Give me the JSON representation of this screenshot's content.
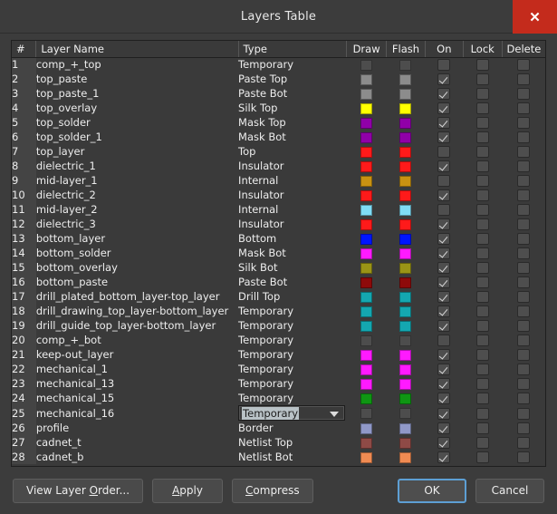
{
  "window": {
    "title": "Layers Table",
    "close_icon": "close-icon",
    "close_label": "✕"
  },
  "table": {
    "columns": [
      "#",
      "Layer Name",
      "Type",
      "Draw",
      "Flash",
      "On",
      "Lock",
      "Delete"
    ],
    "rows": [
      {
        "num": "1",
        "name": "comp_+_top",
        "type": "Temporary",
        "draw": "#4d4d4d",
        "flash": "#4d4d4d",
        "on": false,
        "lock": false,
        "delete": false
      },
      {
        "num": "2",
        "name": "top_paste",
        "type": "Paste Top",
        "draw": "#8c8c8c",
        "flash": "#8c8c8c",
        "on": true,
        "lock": false,
        "delete": false
      },
      {
        "num": "3",
        "name": "top_paste_1",
        "type": "Paste Bot",
        "draw": "#8c8c8c",
        "flash": "#8c8c8c",
        "on": true,
        "lock": false,
        "delete": false
      },
      {
        "num": "4",
        "name": "top_overlay",
        "type": "Silk Top",
        "draw": "#ffff00",
        "flash": "#ffff00",
        "on": true,
        "lock": false,
        "delete": false
      },
      {
        "num": "5",
        "name": "top_solder",
        "type": "Mask Top",
        "draw": "#9000a8",
        "flash": "#9000a8",
        "on": true,
        "lock": false,
        "delete": false
      },
      {
        "num": "6",
        "name": "top_solder_1",
        "type": "Mask Bot",
        "draw": "#9000a8",
        "flash": "#9000a8",
        "on": true,
        "lock": false,
        "delete": false
      },
      {
        "num": "7",
        "name": "top_layer",
        "type": "Top",
        "draw": "#ff1a1a",
        "flash": "#ff1a1a",
        "on": false,
        "lock": false,
        "delete": false
      },
      {
        "num": "8",
        "name": "dielectric_1",
        "type": "Insulator",
        "draw": "#ff1a1a",
        "flash": "#ff1a1a",
        "on": true,
        "lock": false,
        "delete": false
      },
      {
        "num": "9",
        "name": "mid-layer_1",
        "type": "Internal",
        "draw": "#c89212",
        "flash": "#c89212",
        "on": false,
        "lock": false,
        "delete": false
      },
      {
        "num": "10",
        "name": "dielectric_2",
        "type": "Insulator",
        "draw": "#ff1a1a",
        "flash": "#ff1a1a",
        "on": true,
        "lock": false,
        "delete": false
      },
      {
        "num": "11",
        "name": "mid-layer_2",
        "type": "Internal",
        "draw": "#7fdcf5",
        "flash": "#7fdcf5",
        "on": false,
        "lock": false,
        "delete": false
      },
      {
        "num": "12",
        "name": "dielectric_3",
        "type": "Insulator",
        "draw": "#ff1a1a",
        "flash": "#ff1a1a",
        "on": true,
        "lock": false,
        "delete": false
      },
      {
        "num": "13",
        "name": "bottom_layer",
        "type": "Bottom",
        "draw": "#0015ff",
        "flash": "#0015ff",
        "on": true,
        "lock": false,
        "delete": false
      },
      {
        "num": "14",
        "name": "bottom_solder",
        "type": "Mask Bot",
        "draw": "#ff1aff",
        "flash": "#ff1aff",
        "on": true,
        "lock": false,
        "delete": false
      },
      {
        "num": "15",
        "name": "bottom_overlay",
        "type": "Silk Bot",
        "draw": "#9a9416",
        "flash": "#9a9416",
        "on": true,
        "lock": false,
        "delete": false
      },
      {
        "num": "16",
        "name": "bottom_paste",
        "type": "Paste Bot",
        "draw": "#8e0a0a",
        "flash": "#8e0a0a",
        "on": true,
        "lock": false,
        "delete": false
      },
      {
        "num": "17",
        "name": "drill_plated_bottom_layer-top_layer",
        "type": "Drill Top",
        "draw": "#14a7b0",
        "flash": "#14a7b0",
        "on": true,
        "lock": false,
        "delete": false
      },
      {
        "num": "18",
        "name": "drill_drawing_top_layer-bottom_layer",
        "type": "Temporary",
        "draw": "#14a7b0",
        "flash": "#14a7b0",
        "on": true,
        "lock": false,
        "delete": false
      },
      {
        "num": "19",
        "name": "drill_guide_top_layer-bottom_layer",
        "type": "Temporary",
        "draw": "#14a7b0",
        "flash": "#14a7b0",
        "on": true,
        "lock": false,
        "delete": false
      },
      {
        "num": "20",
        "name": "comp_+_bot",
        "type": "Temporary",
        "draw": "#4d4d4d",
        "flash": "#4d4d4d",
        "on": false,
        "lock": false,
        "delete": false
      },
      {
        "num": "21",
        "name": "keep-out_layer",
        "type": "Temporary",
        "draw": "#ff1aff",
        "flash": "#ff1aff",
        "on": true,
        "lock": false,
        "delete": false
      },
      {
        "num": "22",
        "name": "mechanical_1",
        "type": "Temporary",
        "draw": "#ff1aff",
        "flash": "#ff1aff",
        "on": true,
        "lock": false,
        "delete": false
      },
      {
        "num": "23",
        "name": "mechanical_13",
        "type": "Temporary",
        "draw": "#ff1aff",
        "flash": "#ff1aff",
        "on": true,
        "lock": false,
        "delete": false
      },
      {
        "num": "24",
        "name": "mechanical_15",
        "type": "Temporary",
        "draw": "#0f9613",
        "flash": "#0f9613",
        "on": true,
        "lock": false,
        "delete": false
      },
      {
        "num": "25",
        "name": "mechanical_16",
        "type": "Temporary",
        "draw": "#4d4d4d",
        "flash": "#4d4d4d",
        "on": true,
        "lock": false,
        "delete": false,
        "type_is_combo": true
      },
      {
        "num": "26",
        "name": "profile",
        "type": "Border",
        "draw": "#9098c8",
        "flash": "#9098c8",
        "on": true,
        "lock": false,
        "delete": false
      },
      {
        "num": "27",
        "name": "cadnet_t",
        "type": "Netlist Top",
        "draw": "#8e4a46",
        "flash": "#8e4a46",
        "on": true,
        "lock": false,
        "delete": false
      },
      {
        "num": "28",
        "name": "cadnet_b",
        "type": "Netlist Bot",
        "draw": "#f08b52",
        "flash": "#f08b52",
        "on": true,
        "lock": false,
        "delete": false
      }
    ]
  },
  "footer": {
    "view_layer_order": "View Layer Order...",
    "view_layer_order_pre": "View Layer ",
    "view_layer_order_mn": "O",
    "view_layer_order_post": "rder...",
    "apply_mn": "A",
    "apply_post": "pply",
    "compress_mn": "C",
    "compress_post": "ompress",
    "ok": "OK",
    "cancel": "Cancel"
  },
  "colors": {
    "accent_focus": "#5d9fd4",
    "close_red": "#c42b1c",
    "dialog_bg": "#3c3c3c",
    "grid_bg": "#3a3a3a"
  }
}
